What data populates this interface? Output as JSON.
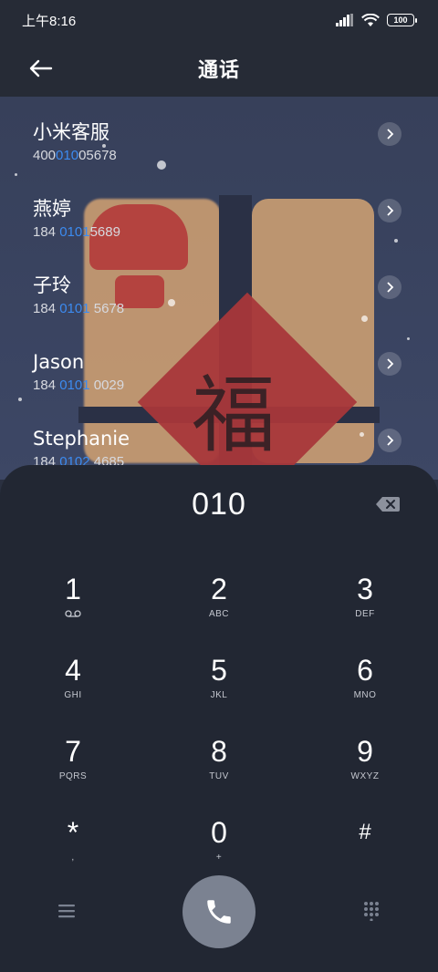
{
  "status_bar": {
    "time": "上午8:16",
    "battery": "100"
  },
  "header": {
    "title": "通话"
  },
  "contacts": [
    {
      "name": "小米客服",
      "num_pre": "400",
      "num_hl": "010",
      "num_post": "05678"
    },
    {
      "name": "燕婷",
      "num_pre": "184 ",
      "num_hl": "0101",
      "num_post": "5689"
    },
    {
      "name": "子玲",
      "num_pre": "184 ",
      "num_hl": "0101",
      "num_post": " 5678"
    },
    {
      "name": "Jason",
      "num_pre": "184 ",
      "num_hl": "0101",
      "num_post": " 0029"
    },
    {
      "name": "Stephanie",
      "num_pre": "184 ",
      "num_hl": "0102",
      "num_post": " 4685"
    }
  ],
  "dialer": {
    "number": "010",
    "keys": [
      {
        "digit": "1",
        "letters": ""
      },
      {
        "digit": "2",
        "letters": "ABC"
      },
      {
        "digit": "3",
        "letters": "DEF"
      },
      {
        "digit": "4",
        "letters": "GHI"
      },
      {
        "digit": "5",
        "letters": "JKL"
      },
      {
        "digit": "6",
        "letters": "MNO"
      },
      {
        "digit": "7",
        "letters": "PQRS"
      },
      {
        "digit": "8",
        "letters": "TUV"
      },
      {
        "digit": "9",
        "letters": "WXYZ"
      },
      {
        "digit": "*",
        "letters": ","
      },
      {
        "digit": "0",
        "letters": "+"
      },
      {
        "digit": "#",
        "letters": ""
      }
    ]
  },
  "icons": {
    "back": "back-arrow-icon",
    "delete": "backspace-icon",
    "voicemail": "voicemail-icon",
    "menu": "menu-icon",
    "call": "phone-icon",
    "keypad": "keypad-dots-icon"
  },
  "colors": {
    "highlight": "#3c8bf0",
    "call_button": "#7b8291",
    "dialer_bg": "#222733"
  }
}
